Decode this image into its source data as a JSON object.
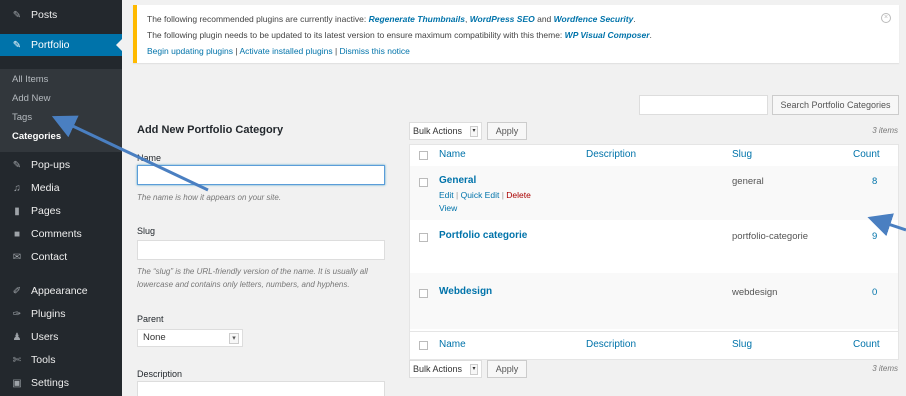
{
  "sidebar": {
    "items": [
      {
        "label": "Posts",
        "icon": "pin-icon",
        "glyph": "✎"
      },
      {
        "label": "Portfolio",
        "icon": "pin-icon",
        "glyph": "✎",
        "active": true
      },
      {
        "label": "Pop-ups",
        "icon": "pin-icon",
        "glyph": "✎"
      },
      {
        "label": "Media",
        "icon": "media-icon",
        "glyph": "♫"
      },
      {
        "label": "Pages",
        "icon": "pages-icon",
        "glyph": "▮"
      },
      {
        "label": "Comments",
        "icon": "comments-icon",
        "glyph": "■"
      },
      {
        "label": "Contact",
        "icon": "contact-icon",
        "glyph": "✉"
      },
      {
        "label": "Appearance",
        "icon": "appearance-icon",
        "glyph": "✐"
      },
      {
        "label": "Plugins",
        "icon": "plugins-icon",
        "glyph": "✑"
      },
      {
        "label": "Users",
        "icon": "users-icon",
        "glyph": "♟"
      },
      {
        "label": "Tools",
        "icon": "tools-icon",
        "glyph": "✄"
      },
      {
        "label": "Settings",
        "icon": "settings-icon",
        "glyph": "▣"
      }
    ],
    "submenu": [
      "All Items",
      "Add New",
      "Tags",
      "Categories"
    ]
  },
  "notice": {
    "line1_prefix": "The following recommended plugins are currently inactive: ",
    "plugin1": "Regenerate Thumbnails",
    "sep1": ", ",
    "plugin2": "WordPress SEO",
    "and": " and ",
    "plugin3": "Wordfence Security",
    "line1_suffix": ".",
    "line2_prefix": "The following plugin needs to be updated to its latest version to ensure maximum compatibility with this theme: ",
    "plugin4": "WP Visual Composer",
    "line2_suffix": ".",
    "action_begin": "Begin updating plugins",
    "action_activate": "Activate installed plugins",
    "action_dismiss": "Dismiss this notice",
    "action_sep": " | ",
    "close_glyph": "×"
  },
  "search": {
    "button": "Search Portfolio Categories",
    "value": ""
  },
  "form": {
    "title": "Add New Portfolio Category",
    "name_label": "Name",
    "name_help": "The name is how it appears on your site.",
    "slug_label": "Slug",
    "slug_help": "The “slug” is the URL-friendly version of the name. It is usually all lowercase and contains only letters, numbers, and hyphens.",
    "parent_label": "Parent",
    "parent_value": "None",
    "description_label": "Description"
  },
  "bulk": {
    "label": "Bulk Actions",
    "apply": "Apply",
    "count": "3 items"
  },
  "table": {
    "headers": {
      "name": "Name",
      "description": "Description",
      "slug": "Slug",
      "count": "Count"
    },
    "rows": [
      {
        "name": "General",
        "description": "",
        "slug": "general",
        "count": "8"
      },
      {
        "name": "Portfolio categorie",
        "description": "",
        "slug": "portfolio-categorie",
        "count": "9"
      },
      {
        "name": "Webdesign",
        "description": "",
        "slug": "webdesign",
        "count": "0"
      }
    ],
    "row_actions": {
      "edit": "Edit",
      "quick_edit": "Quick Edit",
      "delete": "Delete",
      "view": "View",
      "sep": " | "
    }
  },
  "colors": {
    "sidebar_bg": "#23282d",
    "accent": "#0073aa",
    "notice_border": "#ffba00",
    "annotation": "#4a7fc1"
  }
}
